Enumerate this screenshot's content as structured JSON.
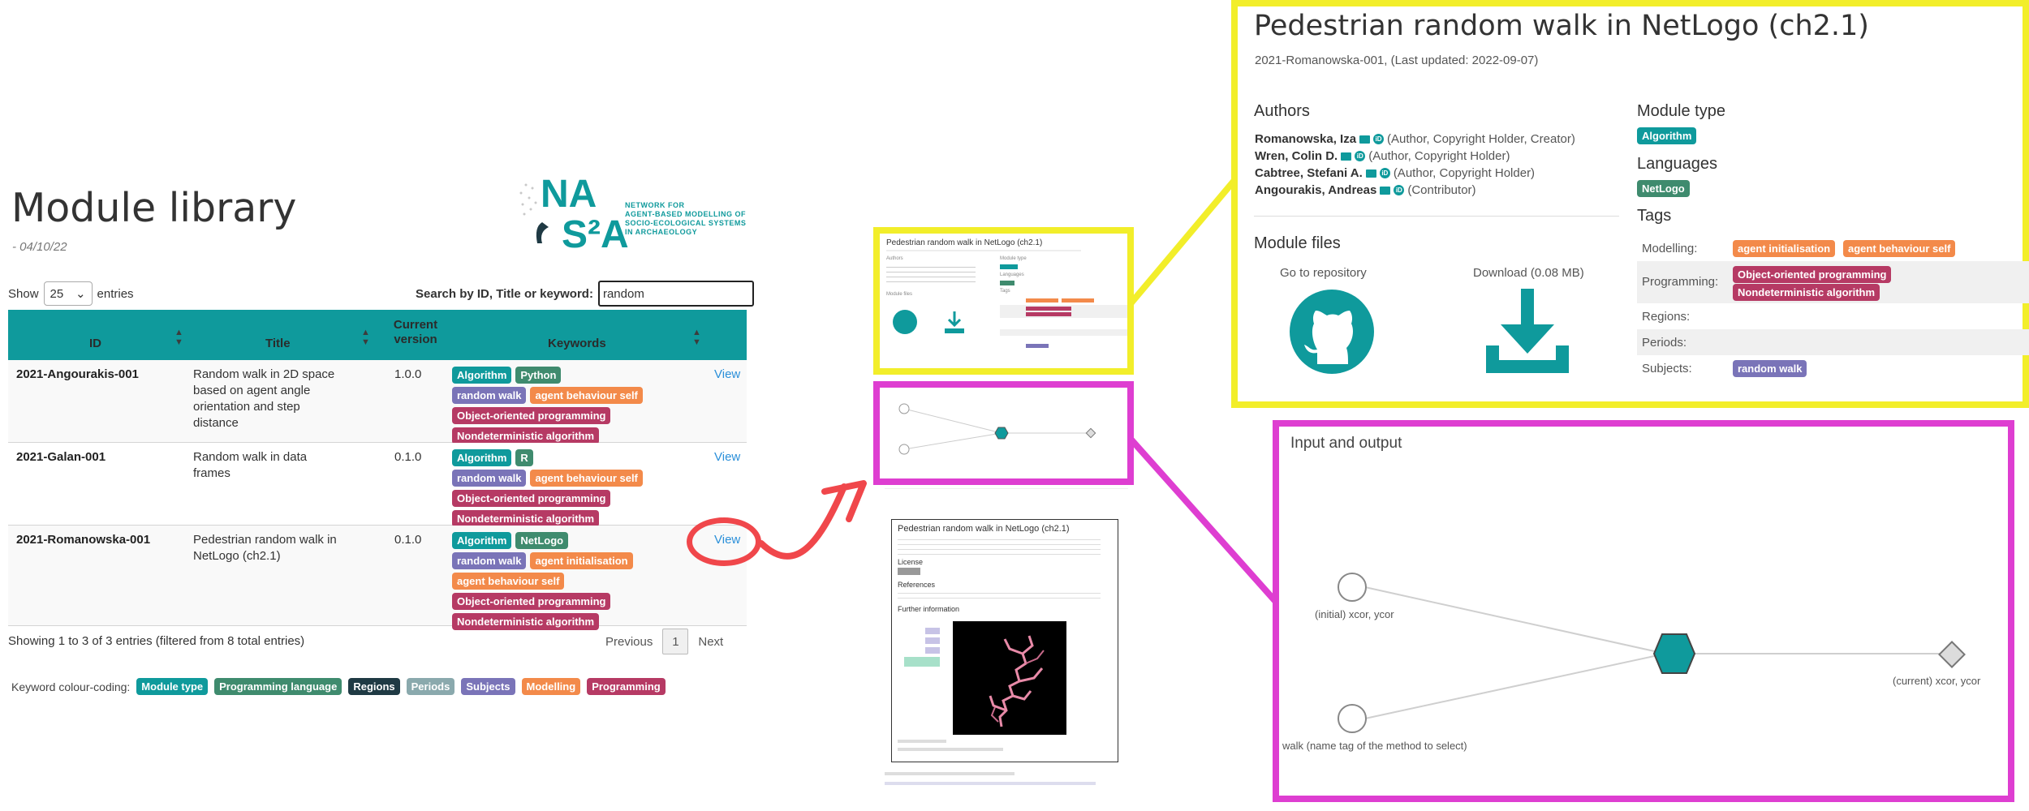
{
  "library": {
    "title": "Module library",
    "date": "- 04/10/22",
    "show_label": "Show",
    "show_value": "25",
    "entries_label": "entries",
    "search_label": "Search by ID, Title or keyword:",
    "search_value": "random",
    "logo": {
      "na": "NA",
      "s2a": "S²A",
      "tagline_1": "NETWORK FOR",
      "tagline_2": "AGENT-BASED MODELLING OF",
      "tagline_3": "SOCIO-ECOLOGICAL SYSTEMS",
      "tagline_4": "IN ARCHAEOLOGY"
    },
    "columns": {
      "id": "ID",
      "title": "Title",
      "version_1": "Current",
      "version_2": "version",
      "keywords": "Keywords"
    },
    "rows": [
      {
        "id": "2021-Angourakis-001",
        "title": "Random walk in 2D space based on agent angle orientation and step distance",
        "version": "1.0.0",
        "view": "View",
        "kw": [
          "Algorithm",
          "Python",
          "random walk",
          "agent behaviour self",
          "Object-oriented programming",
          "Nondeterministic algorithm"
        ]
      },
      {
        "id": "2021-Galan-001",
        "title": "Random walk in data frames",
        "version": "0.1.0",
        "view": "View",
        "kw": [
          "Algorithm",
          "R",
          "random walk",
          "agent behaviour self",
          "Object-oriented programming",
          "Nondeterministic algorithm"
        ]
      },
      {
        "id": "2021-Romanowska-001",
        "title": "Pedestrian random walk in NetLogo (ch2.1)",
        "version": "0.1.0",
        "view": "View",
        "kw": [
          "Algorithm",
          "NetLogo",
          "random walk",
          "agent initialisation",
          "agent behaviour self",
          "Object-oriented programming",
          "Nondeterministic algorithm"
        ]
      }
    ],
    "footer_info": "Showing 1 to 3 of 3 entries (filtered from 8 total entries)",
    "pager": {
      "previous": "Previous",
      "page": "1",
      "next": "Next"
    },
    "legend": {
      "label": "Keyword colour-coding:",
      "items": [
        "Module type",
        "Programming language",
        "Regions",
        "Periods",
        "Subjects",
        "Modelling",
        "Programming"
      ]
    }
  },
  "detail": {
    "title": "Pedestrian random walk in NetLogo (ch2.1)",
    "subtitle": "2021-Romanowska-001, (Last updated: 2022-09-07)",
    "authors_heading": "Authors",
    "authors": [
      {
        "name": "Romanowska, Iza",
        "role": "(Author, Copyright Holder, Creator)"
      },
      {
        "name": "Wren, Colin D.",
        "role": "(Author, Copyright Holder)"
      },
      {
        "name": "Cabtree, Stefani A.",
        "role": "(Author, Copyright Holder)"
      },
      {
        "name": "Angourakis, Andreas",
        "role": "(Contributor)"
      }
    ],
    "module_type_heading": "Module type",
    "module_type": "Algorithm",
    "languages_heading": "Languages",
    "language": "NetLogo",
    "tags_heading": "Tags",
    "tags": {
      "modelling_label": "Modelling:",
      "modelling": [
        "agent initialisation",
        "agent behaviour self"
      ],
      "programming_label": "Programming:",
      "programming": [
        "Object-oriented programming",
        "Nondeterministic algorithm"
      ],
      "regions_label": "Regions:",
      "periods_label": "Periods:",
      "subjects_label": "Subjects:",
      "subjects": [
        "random walk"
      ]
    },
    "files_heading": "Module files",
    "repo_label": "Go to repository",
    "download_label": "Download (0.08 MB)"
  },
  "io": {
    "title": "Input and output",
    "input_1": "(initial) xcor, ycor",
    "input_2": "walk (name tag of the method to select)",
    "output": "(current) xcor, ycor"
  },
  "mini": {
    "doc_title": "Pedestrian random walk in NetLogo (ch2.1)",
    "license": "License",
    "references": "References",
    "further": "Further information",
    "module_files": "Module files",
    "authors": "Authors",
    "module_type": "Module type",
    "languages": "Languages",
    "tags": "Tags"
  },
  "colors": {
    "teal": "#0f9a9c",
    "highlight_yellow": "#f2ee2a",
    "highlight_magenta": "#de3ed1",
    "arrow_red": "#f0474b",
    "modelling": "#f38a4a",
    "programming": "#b63a64",
    "subjects": "#7a74b8",
    "language": "#3f8b6e"
  }
}
